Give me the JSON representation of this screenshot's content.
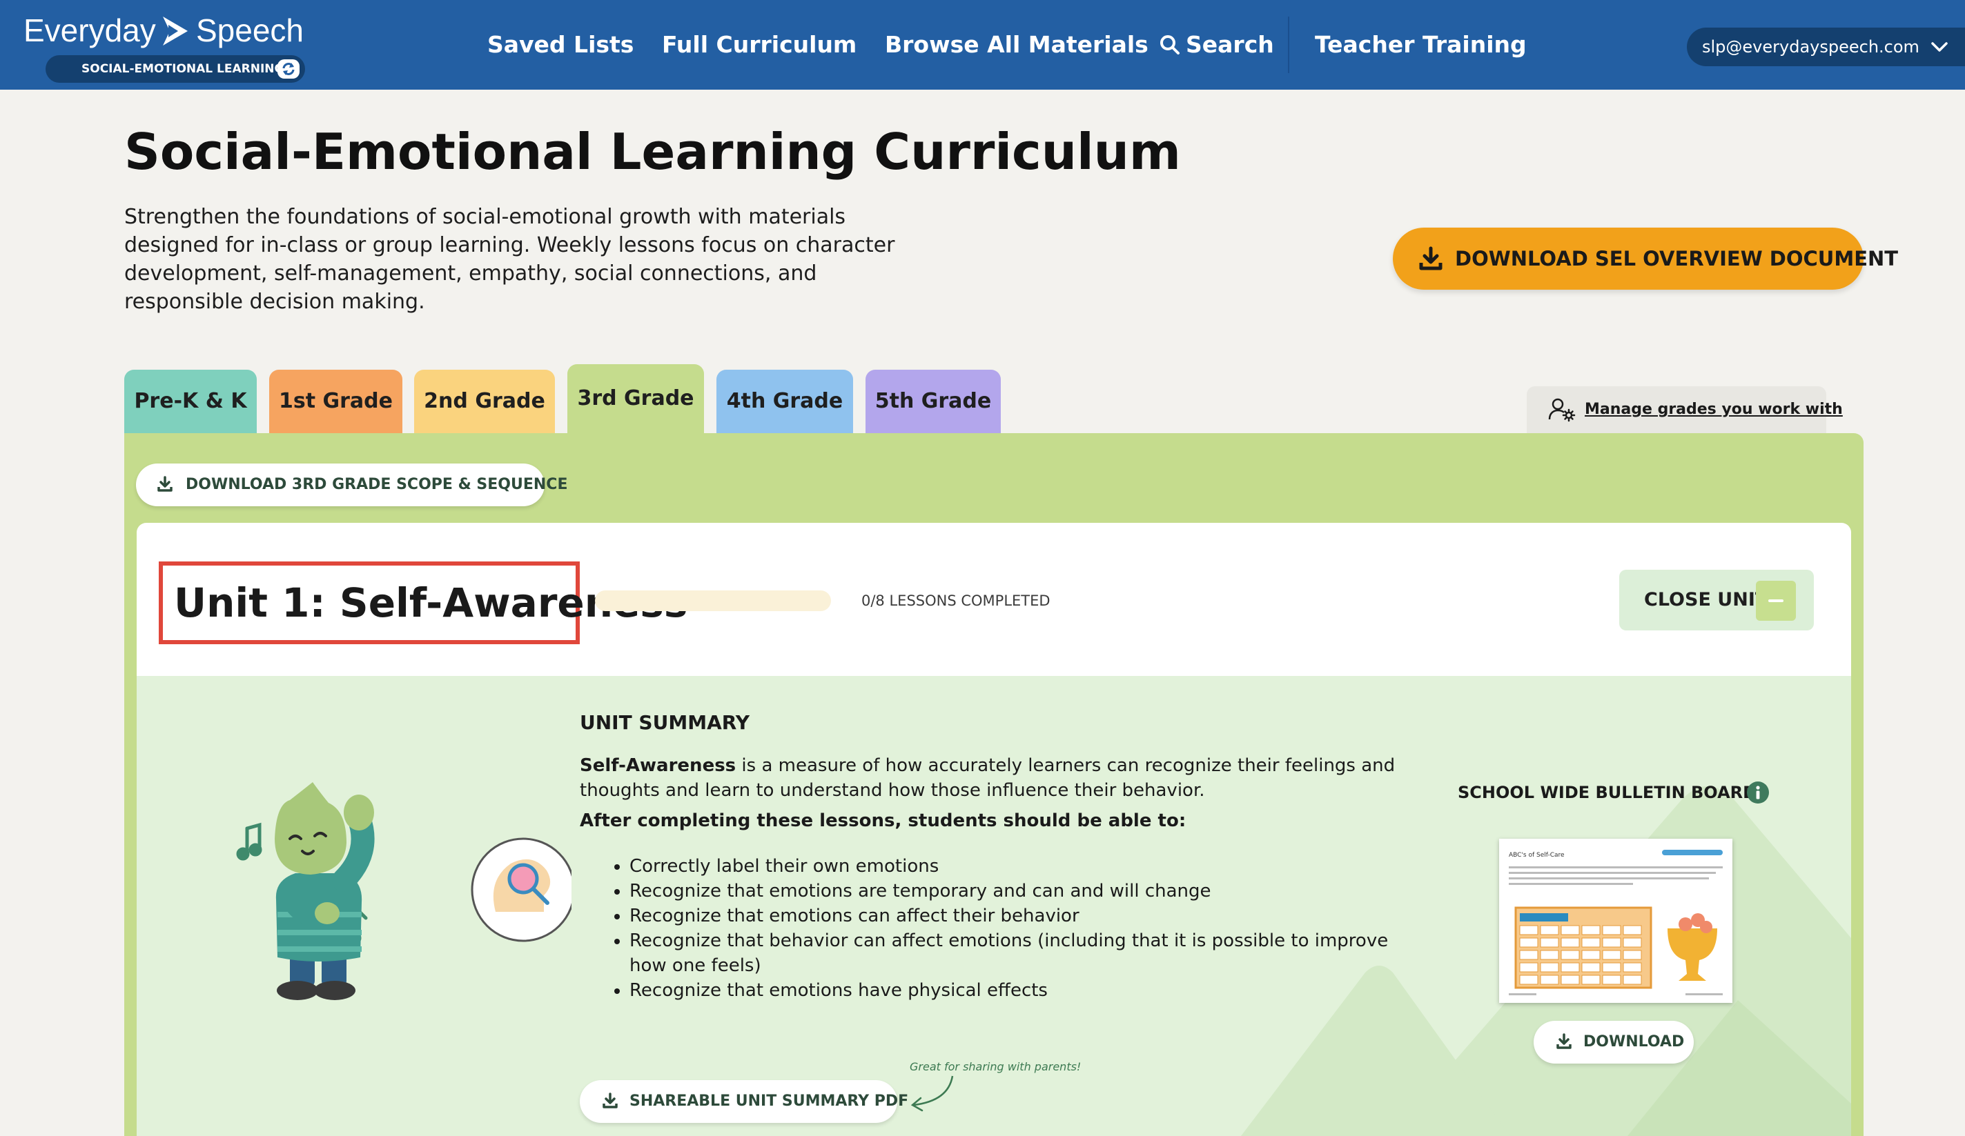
{
  "topbar": {
    "logo_word_1": "Everyday",
    "logo_word_2": "Speech",
    "logo_badge": "SOCIAL-EMOTIONAL LEARNING",
    "nav": [
      {
        "label": "Saved Lists"
      },
      {
        "label": "Full Curriculum"
      },
      {
        "label": "Browse All Materials"
      },
      {
        "label": "Search"
      },
      {
        "label": "Teacher Training"
      }
    ],
    "account_email": "slp@everydayspeech.com",
    "colors": {
      "bar": "#235fa3",
      "pill": "#14406f"
    }
  },
  "header": {
    "title": "Social-Emotional Learning Curriculum",
    "description": "Strengthen the foundations of social-emotional growth with materials designed for in-class or group learning. Weekly lessons focus on character development, self-management, empathy, social connections, and responsible decision making.",
    "overview_button": "DOWNLOAD SEL OVERVIEW DOCUMENT",
    "overview_button_color": "#f2a11a"
  },
  "grade_tabs": {
    "active": "3rd Grade",
    "items": [
      {
        "label": "Pre-K & K",
        "color": "#7fd0bd"
      },
      {
        "label": "1st Grade",
        "color": "#f6a460"
      },
      {
        "label": "2nd Grade",
        "color": "#fad37e"
      },
      {
        "label": "3rd Grade",
        "color": "#c5dc8d"
      },
      {
        "label": "4th Grade",
        "color": "#8fc2ee"
      },
      {
        "label": "5th Grade",
        "color": "#b3a6ec"
      }
    ],
    "manage_link": "Manage grades you work with"
  },
  "panel": {
    "scope_button": "DOWNLOAD 3RD GRADE SCOPE & SEQUENCE",
    "unit": {
      "title": "Unit 1: Self-Awareness",
      "progress_fraction": 0,
      "lessons_completed": "0/8 LESSONS COMPLETED",
      "close_button": "CLOSE UNIT"
    },
    "summary": {
      "heading": "UNIT SUMMARY",
      "term": "Self-Awareness",
      "definition_rest": " is a measure of how accurately learners can recognize their feelings and thoughts and learn to understand how those influence their behavior.",
      "objectives_heading": "After completing these lessons, students should be able to:",
      "objectives": [
        "Correctly label their own emotions",
        "Recognize that emotions are temporary and can and will change",
        "Recognize that emotions can affect their behavior",
        "Recognize that behavior can affect emotions (including that it is possible to improve how one feels)",
        "Recognize that emotions have physical effects"
      ],
      "shareable_button": "SHAREABLE UNIT SUMMARY PDF",
      "share_note": "Great for sharing with parents!"
    },
    "bulletin": {
      "label": "SCHOOL WIDE BULLETIN BOARD",
      "thumb_title": "ABC's of Self-Care",
      "download_button": "DOWNLOAD"
    }
  }
}
